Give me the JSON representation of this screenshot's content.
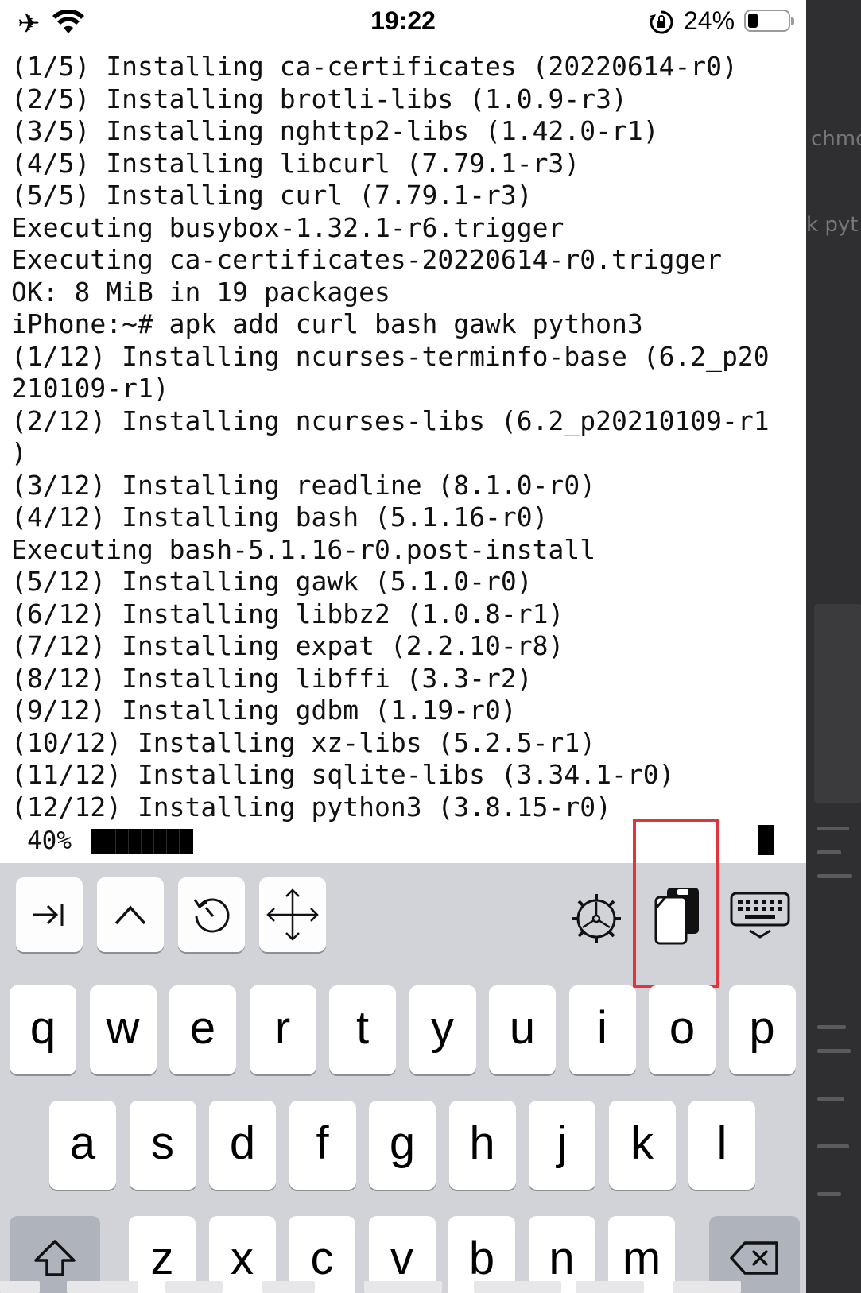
{
  "status_bar": {
    "time": "19:22",
    "battery_pct": "24%",
    "battery_level": 0.24
  },
  "terminal": {
    "lines": [
      "(1/5) Installing ca-certificates (20220614-r0)",
      "(2/5) Installing brotli-libs (1.0.9-r3)",
      "(3/5) Installing nghttp2-libs (1.42.0-r1)",
      "(4/5) Installing libcurl (7.79.1-r3)",
      "(5/5) Installing curl (7.79.1-r3)",
      "Executing busybox-1.32.1-r6.trigger",
      "Executing ca-certificates-20220614-r0.trigger",
      "OK: 8 MiB in 19 packages",
      "iPhone:~# apk add curl bash gawk python3",
      "(1/12) Installing ncurses-terminfo-base (6.2_p20",
      "210109-r1)",
      "(2/12) Installing ncurses-libs (6.2_p20210109-r1",
      ")",
      "(3/12) Installing readline (8.1.0-r0)",
      "(4/12) Installing bash (5.1.16-r0)",
      "Executing bash-5.1.16-r0.post-install",
      "(5/12) Installing gawk (5.1.0-r0)",
      "(6/12) Installing libbz2 (1.0.8-r1)",
      "(7/12) Installing expat (2.2.10-r8)",
      "(8/12) Installing libffi (3.3-r2)",
      "(9/12) Installing gdbm (1.19-r0)",
      "(10/12) Installing xz-libs (5.2.5-r1)",
      "(11/12) Installing sqlite-libs (3.34.1-r0)",
      "(12/12) Installing python3 (3.8.15-r0)"
    ],
    "progress_label": "40%",
    "progress_value": 0.4
  },
  "toolbar": {
    "icons": [
      "tab-icon",
      "control-caret-icon",
      "history-icon",
      "move-arrows-icon",
      "settings-gear-icon",
      "clipboard-paste-icon",
      "keyboard-dismiss-icon"
    ]
  },
  "keyboard": {
    "row1": [
      "q",
      "w",
      "e",
      "r",
      "t",
      "y",
      "u",
      "i",
      "o",
      "p"
    ],
    "row2": [
      "a",
      "s",
      "d",
      "f",
      "g",
      "h",
      "j",
      "k",
      "l"
    ],
    "row3": [
      "z",
      "x",
      "c",
      "v",
      "b",
      "n",
      "m"
    ]
  },
  "background": {
    "ghost_text_1": "chmo",
    "ghost_text_2": "k pyt"
  },
  "colors": {
    "highlight": "#e2343b",
    "keyboard_bg": "#d1d3d9"
  }
}
